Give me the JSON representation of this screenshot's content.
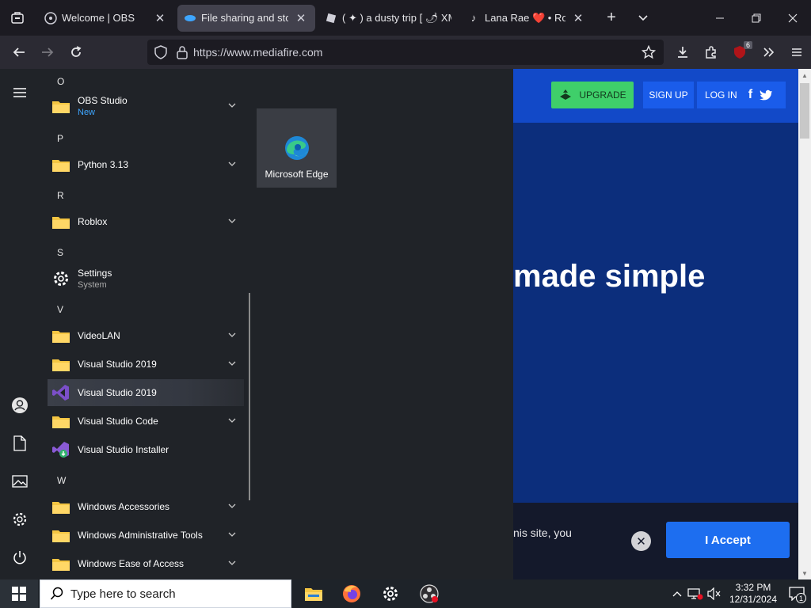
{
  "tabs": [
    {
      "title": "Welcome | OBS",
      "active": false
    },
    {
      "title": "File sharing and storag",
      "active": true
    },
    {
      "title": "( ✦ ) a dusty trip [ 🌶 XM",
      "active": false
    },
    {
      "title": "Lana Rae ❤️ • Roblox",
      "active": false
    }
  ],
  "navbar": {
    "url": "https://www.mediafire.com",
    "extension_badge": "6"
  },
  "site": {
    "upgrade_label": "UPGRADE",
    "signup_label": "SIGN UP",
    "login_label": "LOG IN",
    "hero_text": "made simple",
    "cookie_text": "nis site, you",
    "accept_label": "I Accept",
    "accent_color": "#1249c8"
  },
  "start_menu": {
    "sections": [
      {
        "letter": "O",
        "apps": [
          {
            "name": "OBS Studio",
            "sub": "New",
            "icon": "folder-icon",
            "expandable": true
          }
        ]
      },
      {
        "letter": "P",
        "apps": [
          {
            "name": "Python 3.13",
            "icon": "folder-icon",
            "expandable": true
          }
        ]
      },
      {
        "letter": "R",
        "apps": [
          {
            "name": "Roblox",
            "icon": "folder-icon",
            "expandable": true
          }
        ]
      },
      {
        "letter": "S",
        "apps": [
          {
            "name": "Settings",
            "sub": "System",
            "icon": "gear-icon",
            "expandable": false
          }
        ]
      },
      {
        "letter": "V",
        "apps": [
          {
            "name": "VideoLAN",
            "icon": "folder-icon",
            "expandable": true
          },
          {
            "name": "Visual Studio 2019",
            "icon": "folder-icon",
            "expandable": true
          },
          {
            "name": "Visual Studio 2019",
            "icon": "visual-studio-icon",
            "expandable": false,
            "highlighted": true
          },
          {
            "name": "Visual Studio Code",
            "icon": "folder-icon",
            "expandable": true
          },
          {
            "name": "Visual Studio Installer",
            "icon": "vs-installer-icon",
            "expandable": false
          }
        ]
      },
      {
        "letter": "W",
        "apps": [
          {
            "name": "Windows Accessories",
            "icon": "folder-icon",
            "expandable": true
          },
          {
            "name": "Windows Administrative Tools",
            "icon": "folder-icon",
            "expandable": true
          },
          {
            "name": "Windows Ease of Access",
            "icon": "folder-icon",
            "expandable": true
          }
        ]
      }
    ],
    "pinned_tile": {
      "name": "Microsoft Edge",
      "icon": "edge-icon"
    }
  },
  "taskbar": {
    "search_placeholder": "Type here to search",
    "time": "3:32 PM",
    "date": "12/31/2024",
    "notification_count": "1",
    "pinned_apps": [
      "file-explorer-icon",
      "firefox-icon",
      "settings-icon",
      "obs-icon"
    ]
  }
}
